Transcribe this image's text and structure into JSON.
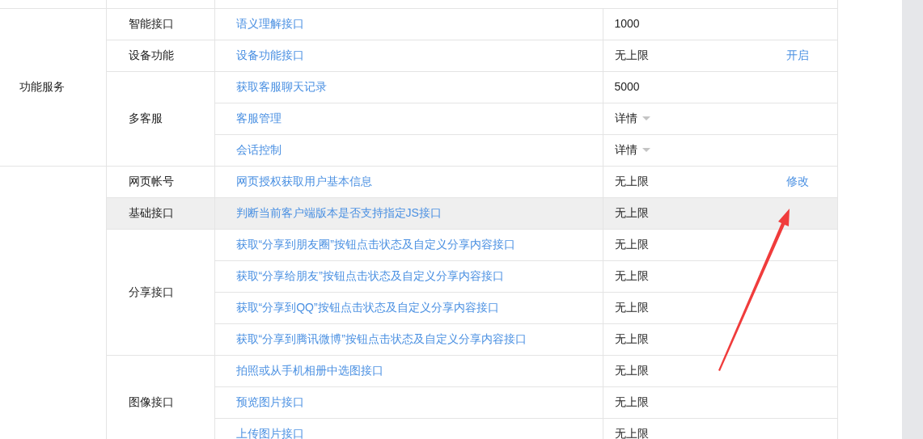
{
  "groups": [
    {
      "category": "功能服务",
      "subgroups": [
        {
          "name": "智能接口",
          "highlighted": false,
          "apis": [
            {
              "name": "语义理解接口",
              "quota": "1000",
              "kind": "text"
            }
          ]
        },
        {
          "name": "设备功能",
          "highlighted": false,
          "apis": [
            {
              "name": "设备功能接口",
              "quota": "无上限",
              "kind": "text",
              "action": "开启"
            }
          ]
        },
        {
          "name": "多客服",
          "highlighted": false,
          "apis": [
            {
              "name": "获取客服聊天记录",
              "quota": "5000",
              "kind": "text"
            },
            {
              "name": "客服管理",
              "quota": "详情",
              "kind": "dropdown"
            },
            {
              "name": "会话控制",
              "quota": "详情",
              "kind": "dropdown"
            }
          ]
        }
      ]
    },
    {
      "subgroups": [
        {
          "name": "网页帐号",
          "highlighted": false,
          "apis": [
            {
              "name": "网页授权获取用户基本信息",
              "quota": "无上限",
              "kind": "text",
              "action": "修改"
            }
          ]
        },
        {
          "name": "基础接口",
          "highlighted": true,
          "apis": [
            {
              "name": "判断当前客户端版本是否支持指定JS接口",
              "quota": "无上限",
              "kind": "text"
            }
          ]
        },
        {
          "name": "分享接口",
          "highlighted": false,
          "apis": [
            {
              "name": "获取“分享到朋友圈”按钮点击状态及自定义分享内容接口",
              "quota": "无上限",
              "kind": "text"
            },
            {
              "name": "获取“分享给朋友”按钮点击状态及自定义分享内容接口",
              "quota": "无上限",
              "kind": "text"
            },
            {
              "name": "获取“分享到QQ”按钮点击状态及自定义分享内容接口",
              "quota": "无上限",
              "kind": "text"
            },
            {
              "name": "获取“分享到腾讯微博”按钮点击状态及自定义分享内容接口",
              "quota": "无上限",
              "kind": "text"
            }
          ]
        },
        {
          "name": "图像接口",
          "highlighted": false,
          "apis": [
            {
              "name": "拍照或从手机相册中选图接口",
              "quota": "无上限",
              "kind": "text"
            },
            {
              "name": "预览图片接口",
              "quota": "无上限",
              "kind": "text"
            },
            {
              "name": "上传图片接口",
              "quota": "无上限",
              "kind": "text"
            }
          ]
        }
      ]
    }
  ]
}
